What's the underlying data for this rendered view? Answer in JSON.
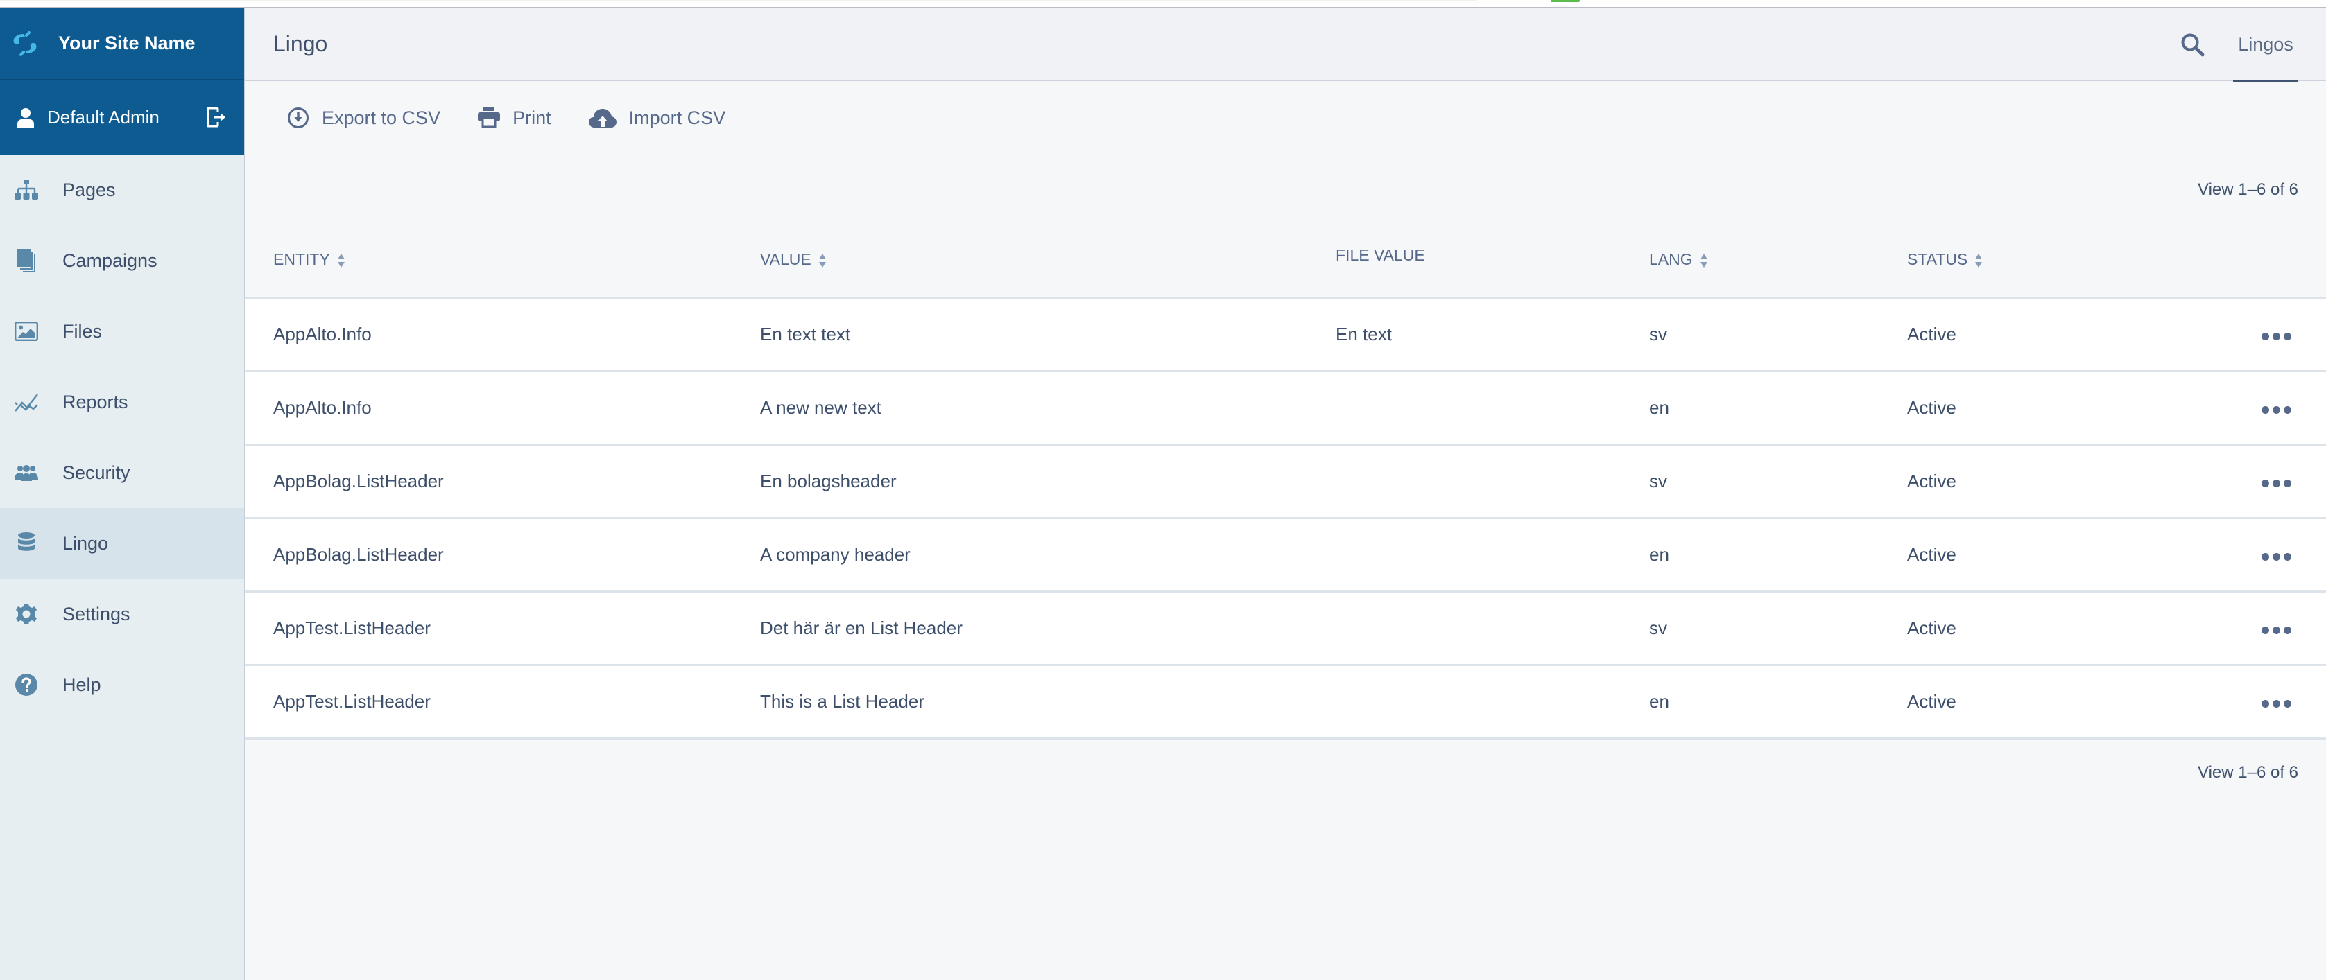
{
  "sidebar": {
    "brand": "Your Site Name",
    "user": "Default Admin",
    "items": [
      {
        "label": "Pages",
        "icon": "sitemap-icon",
        "active": false
      },
      {
        "label": "Campaigns",
        "icon": "documents-icon",
        "active": false
      },
      {
        "label": "Files",
        "icon": "image-icon",
        "active": false
      },
      {
        "label": "Reports",
        "icon": "line-chart-icon",
        "active": false
      },
      {
        "label": "Security",
        "icon": "users-icon",
        "active": false
      },
      {
        "label": "Lingo",
        "icon": "database-icon",
        "active": true
      },
      {
        "label": "Settings",
        "icon": "gear-icon",
        "active": false
      },
      {
        "label": "Help",
        "icon": "help-circle-icon",
        "active": false
      }
    ]
  },
  "header": {
    "title": "Lingo",
    "tab": "Lingos"
  },
  "toolbar": {
    "export_label": "Export to CSV",
    "print_label": "Print",
    "import_label": "Import CSV"
  },
  "pager": {
    "top": "View 1–6 of 6",
    "bottom": "View 1–6 of 6"
  },
  "table": {
    "columns": [
      {
        "label": "ENTITY",
        "sortable": true
      },
      {
        "label": "VALUE",
        "sortable": true
      },
      {
        "label": "FILE VALUE",
        "sortable": false
      },
      {
        "label": "LANG",
        "sortable": true
      },
      {
        "label": "STATUS",
        "sortable": true
      }
    ],
    "rows": [
      {
        "entity": "AppAlto.Info",
        "value": "En text text",
        "file_value": "En text",
        "lang": "sv",
        "status": "Active"
      },
      {
        "entity": "AppAlto.Info",
        "value": "A new new text",
        "file_value": "",
        "lang": "en",
        "status": "Active"
      },
      {
        "entity": "AppBolag.ListHeader",
        "value": "En bolagsheader",
        "file_value": "",
        "lang": "sv",
        "status": "Active"
      },
      {
        "entity": "AppBolag.ListHeader",
        "value": "A company header",
        "file_value": "",
        "lang": "en",
        "status": "Active"
      },
      {
        "entity": "AppTest.ListHeader",
        "value": "Det här är en List Header",
        "file_value": "",
        "lang": "sv",
        "status": "Active"
      },
      {
        "entity": "AppTest.ListHeader",
        "value": "This is a List Header",
        "file_value": "",
        "lang": "en",
        "status": "Active"
      }
    ]
  },
  "colors": {
    "brand": "#0d5b91",
    "logo_accent": "#46b8e8",
    "icon": "#5a88a8",
    "text": "#3d4f6a"
  }
}
